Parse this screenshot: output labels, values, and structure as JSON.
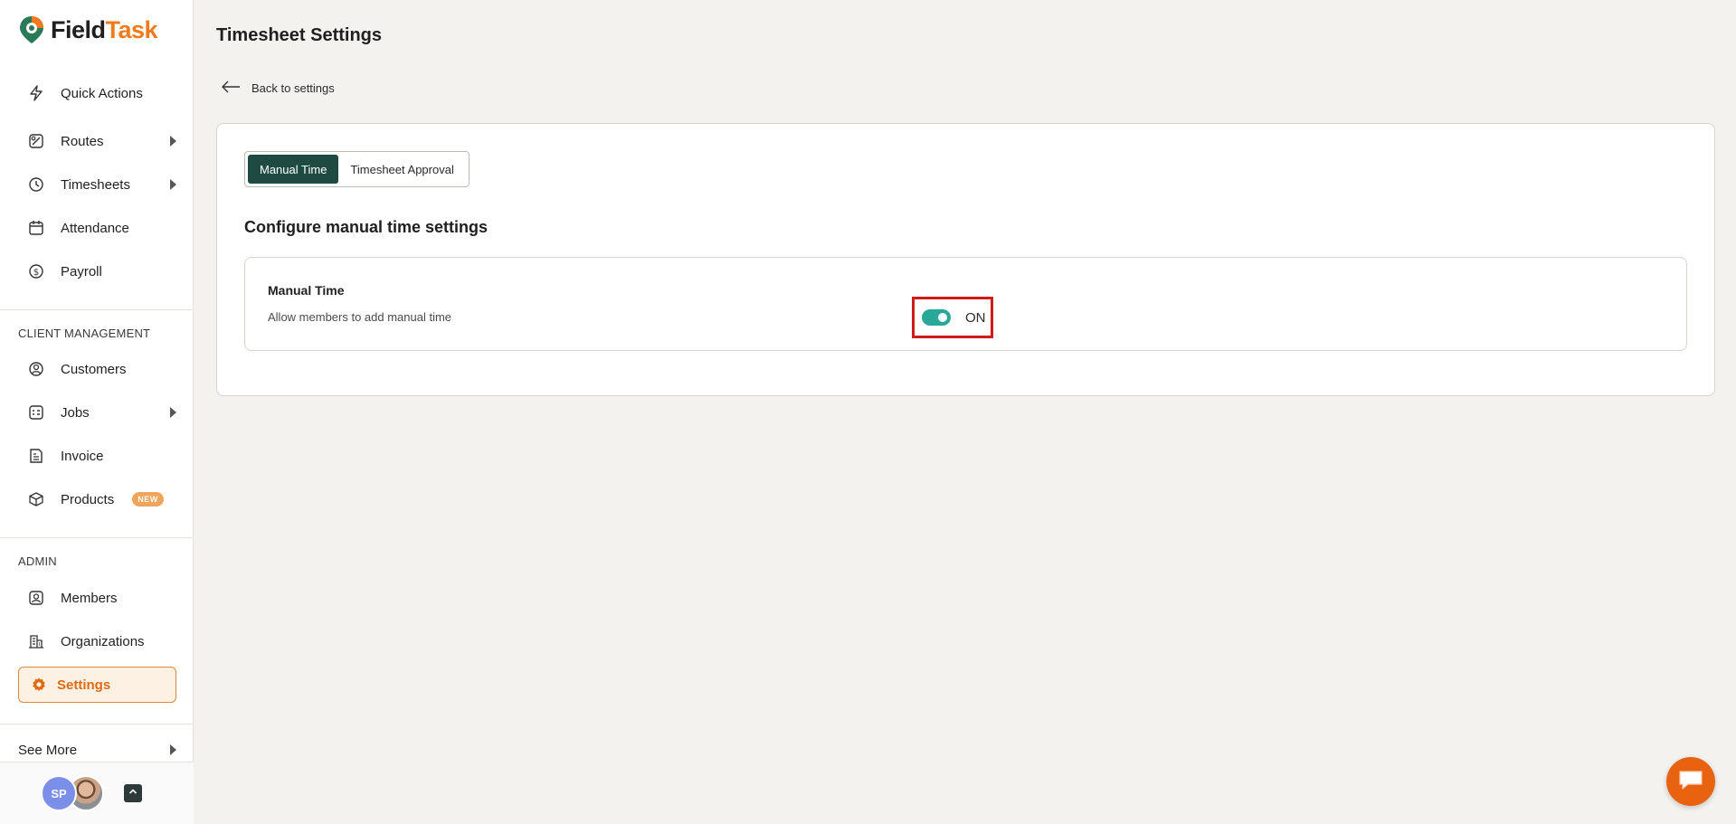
{
  "brand": {
    "name_part1": "Field",
    "name_part2": "Task",
    "primary_color": "#f07a1c",
    "accent_green": "#1f4a42"
  },
  "sidebar": {
    "items": [
      {
        "label": "Quick Actions",
        "icon": "bolt-icon",
        "has_submenu": false
      },
      {
        "label": "Routes",
        "icon": "route-map-icon",
        "has_submenu": true
      },
      {
        "label": "Timesheets",
        "icon": "clock-icon",
        "has_submenu": true
      },
      {
        "label": "Attendance",
        "icon": "calendar-icon",
        "has_submenu": false
      },
      {
        "label": "Payroll",
        "icon": "dollar-coin-icon",
        "has_submenu": false
      }
    ],
    "client_management": {
      "label": "CLIENT MANAGEMENT",
      "items": [
        {
          "label": "Customers",
          "icon": "user-circle-icon",
          "has_submenu": false
        },
        {
          "label": "Jobs",
          "icon": "job-list-icon",
          "has_submenu": true
        },
        {
          "label": "Invoice",
          "icon": "invoice-icon",
          "has_submenu": false
        },
        {
          "label": "Products",
          "icon": "cube-icon",
          "badge": "NEW"
        }
      ]
    },
    "admin": {
      "label": "ADMIN",
      "items": [
        {
          "label": "Members",
          "icon": "member-icon"
        },
        {
          "label": "Organizations",
          "icon": "building-icon"
        },
        {
          "label": "Settings",
          "icon": "gear-icon",
          "active": true
        }
      ]
    },
    "see_more": "See More",
    "user": {
      "initials": "SP"
    }
  },
  "main": {
    "title": "Timesheet Settings",
    "back_label": "Back to settings",
    "tabs": [
      {
        "label": "Manual Time",
        "active": true
      },
      {
        "label": "Timesheet Approval",
        "active": false
      }
    ],
    "section_title": "Configure manual time settings",
    "setting": {
      "name": "Manual Time",
      "description": "Allow members to add manual time",
      "toggle_state": "ON",
      "enabled": true
    }
  }
}
